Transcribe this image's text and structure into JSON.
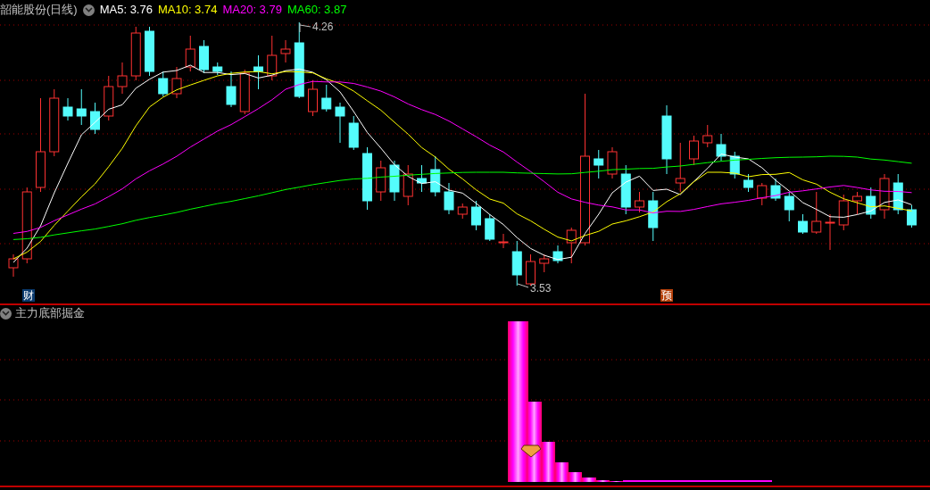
{
  "main_chart": {
    "title": "韶能股份(日线)",
    "moving_averages": [
      {
        "label": "MA5: 3.76",
        "color": "#ffffff"
      },
      {
        "label": "MA10: 3.74",
        "color": "#ffff00"
      },
      {
        "label": "MA20: 3.79",
        "color": "#ff00ff"
      },
      {
        "label": "MA60: 3.87",
        "color": "#00ff00"
      }
    ],
    "high_label": "4.26",
    "low_label": "3.53",
    "event_markers": [
      {
        "text": "财",
        "color": "#0a3a6e"
      },
      {
        "text": "预",
        "color": "#b5400a"
      }
    ]
  },
  "indicator_panel": {
    "title": "主力底部掘金"
  }
}
